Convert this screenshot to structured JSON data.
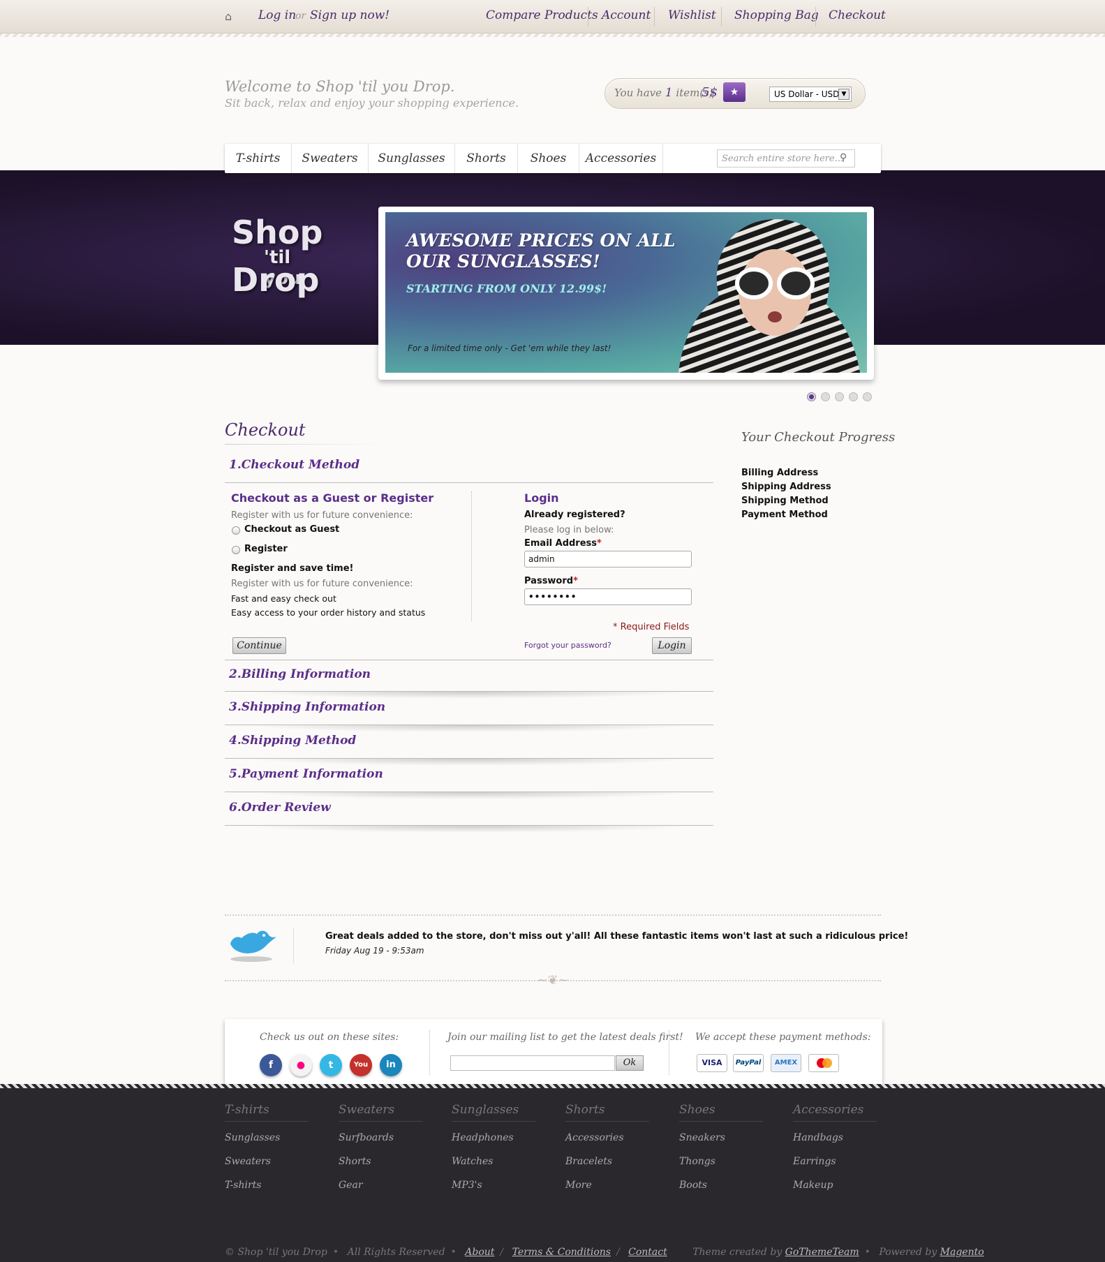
{
  "topbar": {
    "home_icon": "home-icon",
    "login": "Log in",
    "or": "or",
    "signup": "Sign up now!",
    "links": [
      "Compare Products",
      "Account",
      "Wishlist",
      "Shopping Bag",
      "Checkout"
    ]
  },
  "header": {
    "welcome_title": "Welcome to Shop 'til you Drop.",
    "welcome_sub": "Sit back, relax and enjoy your shopping experience.",
    "cart_prefix": "You have",
    "cart_count": "1",
    "cart_suffix": "item(s)",
    "cart_price": "5$",
    "currency": "US Dollar - USD"
  },
  "nav": {
    "items": [
      "T-shirts",
      "Sweaters",
      "Sunglasses",
      "Shorts",
      "Shoes",
      "Accessories"
    ],
    "search_placeholder": "Search entire store here..."
  },
  "logo": {
    "line1": "Shop",
    "line2": "'til you",
    "line3": "Drop"
  },
  "banner": {
    "headline": "AWESOME PRICES ON ALL OUR SUNGLASSES!",
    "subline": "STARTING FROM ONLY 12.99$!",
    "note": "For a limited time only - Get 'em while they last!",
    "slides": 5,
    "active_slide": 1
  },
  "checkout": {
    "title": "Checkout",
    "sections": [
      "1.Checkout Method",
      "2.Billing Information",
      "3.Shipping Information",
      "4.Shipping Method",
      "5.Payment Information",
      "6.Order Review"
    ],
    "guest": {
      "heading": "Checkout as a Guest or Register",
      "intro": "Register with us for future convenience:",
      "option_guest": "Checkout as Guest",
      "option_register": "Register",
      "save_time": "Register and save time!",
      "intro2": "Register with us for future convenience:",
      "benefit1": "Fast and easy check out",
      "benefit2": "Easy access to your order history and status",
      "continue": "Continue"
    },
    "login": {
      "heading": "Login",
      "already": "Already registered?",
      "please": "Please log in below:",
      "email_label": "Email Address",
      "email_value": "admin",
      "password_label": "Password",
      "password_value": "••••••••",
      "required": "* Required Fields",
      "forgot": "Forgot your password?",
      "login_button": "Login"
    }
  },
  "progress": {
    "title": "Your Checkout Progress",
    "items": [
      "Billing Address",
      "Shipping Address",
      "Shipping Method",
      "Payment Method"
    ]
  },
  "twitter": {
    "tweet": "Great deals added to the store, don't miss out y'all! All these fantastic items won't last at such a ridiculous price!",
    "date": "Friday Aug 19 - 9:53am"
  },
  "footer_top": {
    "social_heading": "Check us out on these sites:",
    "mailing_heading": "Join our mailing list to get the latest deals first!",
    "mailing_ok": "Ok",
    "payment_heading": "We accept these payment methods:",
    "social_icons": [
      "facebook-icon",
      "flickr-icon",
      "twitter-icon",
      "youtube-icon",
      "linkedin-icon"
    ],
    "payments": [
      "VISA",
      "PayPal",
      "AMEX",
      "MasterCard"
    ]
  },
  "footer_columns": [
    {
      "title": "T-shirts",
      "items": [
        "Sunglasses",
        "Sweaters",
        "T-shirts"
      ]
    },
    {
      "title": "Sweaters",
      "items": [
        "Surfboards",
        "Shorts",
        "Gear"
      ]
    },
    {
      "title": "Sunglasses",
      "items": [
        "Headphones",
        "Watches",
        "MP3's"
      ]
    },
    {
      "title": "Shorts",
      "items": [
        "Accessories",
        "Bracelets",
        "More"
      ]
    },
    {
      "title": "Shoes",
      "items": [
        "Sneakers",
        "Thongs",
        "Boots"
      ]
    },
    {
      "title": "Accessories",
      "items": [
        "Handbags",
        "Earrings",
        "Makeup"
      ]
    }
  ],
  "footer_bottom": {
    "copyright": "© Shop 'til you Drop",
    "rights": "All Rights Reserved",
    "about": "About",
    "terms": "Terms & Conditions",
    "contact": "Contact",
    "theme_by": "Theme created by",
    "theme_author": "GoThemeTeam",
    "powered_by": "Powered by",
    "powered_link": "Magento"
  }
}
